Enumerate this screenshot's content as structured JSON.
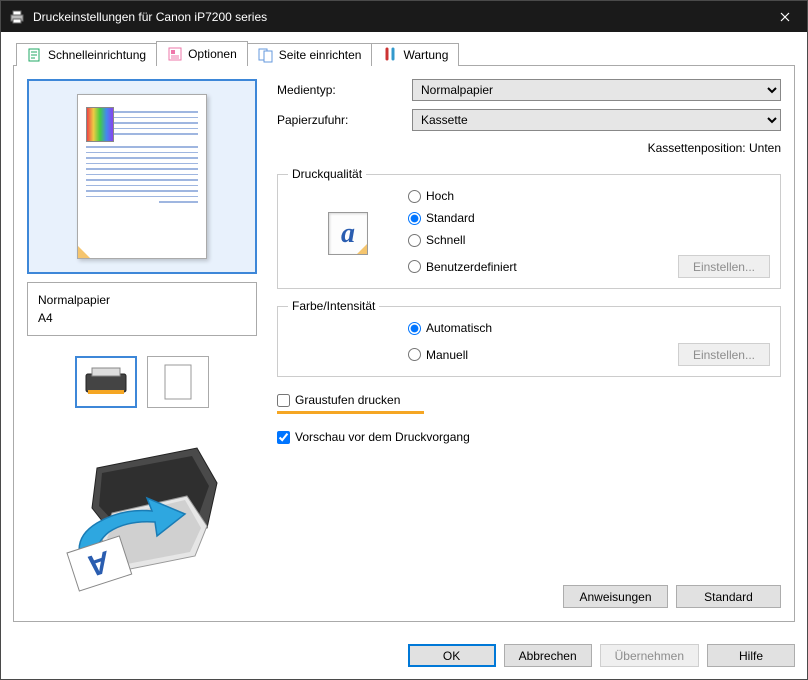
{
  "window": {
    "title": "Druckeinstellungen für Canon iP7200 series"
  },
  "tabs": [
    {
      "label": "Schnelleinrichtung"
    },
    {
      "label": "Optionen"
    },
    {
      "label": "Seite einrichten"
    },
    {
      "label": "Wartung"
    }
  ],
  "active_tab": 1,
  "preview": {
    "media_name": "Normalpapier",
    "paper_size": "A4"
  },
  "media_type": {
    "label": "Medientyp:",
    "value": "Normalpapier"
  },
  "paper_source": {
    "label": "Papierzufuhr:",
    "value": "Kassette"
  },
  "cassette_hint": "Kassettenposition: Unten",
  "quality": {
    "legend": "Druckqualität",
    "high": "Hoch",
    "standard": "Standard",
    "fast": "Schnell",
    "custom": "Benutzerdefiniert",
    "set_btn": "Einstellen...",
    "selected": "standard"
  },
  "color": {
    "legend": "Farbe/Intensität",
    "auto": "Automatisch",
    "manual": "Manuell",
    "set_btn": "Einstellen...",
    "selected": "auto"
  },
  "grayscale": {
    "label": "Graustufen drucken",
    "checked": false
  },
  "preview_print": {
    "label": "Vorschau vor dem Druckvorgang",
    "checked": true
  },
  "inside_buttons": {
    "instructions": "Anweisungen",
    "defaults": "Standard"
  },
  "footer": {
    "ok": "OK",
    "cancel": "Abbrechen",
    "apply": "Übernehmen",
    "help": "Hilfe"
  }
}
